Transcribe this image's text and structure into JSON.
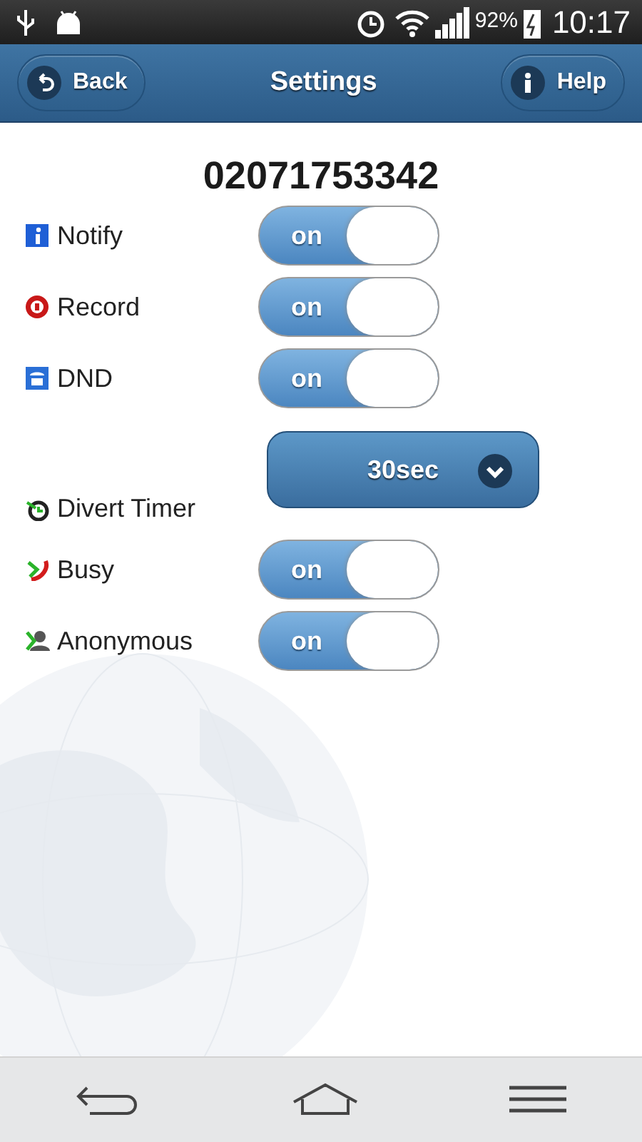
{
  "status_bar": {
    "battery": "92%",
    "time": "10:17"
  },
  "header": {
    "back": "Back",
    "title": "Settings",
    "help": "Help"
  },
  "number": "02071753342",
  "settings": [
    {
      "kind": "toggle",
      "label": "Notify",
      "on": true,
      "state_text": "on"
    },
    {
      "kind": "toggle",
      "label": "Record",
      "on": true,
      "state_text": "on"
    },
    {
      "kind": "toggle",
      "label": "DND",
      "on": true,
      "state_text": "on"
    },
    {
      "kind": "select",
      "label": "Divert Timer",
      "value": "30sec"
    },
    {
      "kind": "toggle",
      "label": "Busy",
      "on": true,
      "state_text": "on"
    },
    {
      "kind": "toggle",
      "label": "Anonymous",
      "on": true,
      "state_text": "on"
    }
  ]
}
